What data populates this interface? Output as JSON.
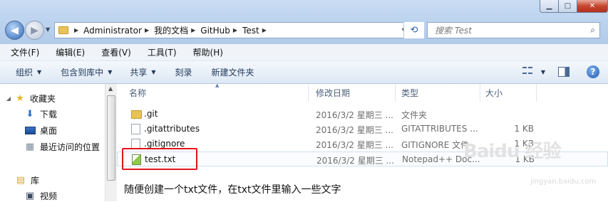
{
  "window": {
    "min_label": "▁",
    "max_label": "□",
    "close_label": "✕"
  },
  "address": {
    "crumbs": [
      "Administrator",
      "我的文档",
      "GitHub",
      "Test"
    ]
  },
  "search": {
    "placeholder": "搜索 Test"
  },
  "menu": [
    "文件(F)",
    "编辑(E)",
    "查看(V)",
    "工具(T)",
    "帮助(H)"
  ],
  "commands": [
    {
      "label": "组织",
      "dropdown": true
    },
    {
      "label": "包含到库中",
      "dropdown": true
    },
    {
      "label": "共享",
      "dropdown": true
    },
    {
      "label": "刻录",
      "dropdown": false
    },
    {
      "label": "新建文件夹",
      "dropdown": false
    }
  ],
  "nav": {
    "favorites": "收藏夹",
    "downloads": "下载",
    "desktop": "桌面",
    "recent": "最近访问的位置",
    "libraries": "库",
    "videos": "视频"
  },
  "columns": {
    "name": "名称",
    "date": "修改日期",
    "type": "类型",
    "size": "大小"
  },
  "files": [
    {
      "name": ".git",
      "date": "2016/3/2 星期三 ...",
      "type": "文件夹",
      "size": "",
      "icon": "folder-icon"
    },
    {
      "name": ".gitattributes",
      "date": "2016/3/2 星期三 ...",
      "type": "GITATTRIBUTES ...",
      "size": "1 KB",
      "icon": "file-icon"
    },
    {
      "name": ".gitignore",
      "date": "2016/3/2 星期三 ...",
      "type": "GITIGNORE 文件",
      "size": "1 KB",
      "icon": "file-icon"
    },
    {
      "name": "test.txt",
      "date": "2016/3/2 星期三 ...",
      "type": "Notepad++ Doc...",
      "size": "1 KB",
      "icon": "notepad-file-icon"
    }
  ],
  "caption": "随便创建一个txt文件，在txt文件里输入一些文字",
  "watermark": {
    "main": "Baidu 经验",
    "sub": "jingyan.baidu.com"
  },
  "colors": {
    "highlight": "#e0161b",
    "accent": "#1e395b"
  }
}
